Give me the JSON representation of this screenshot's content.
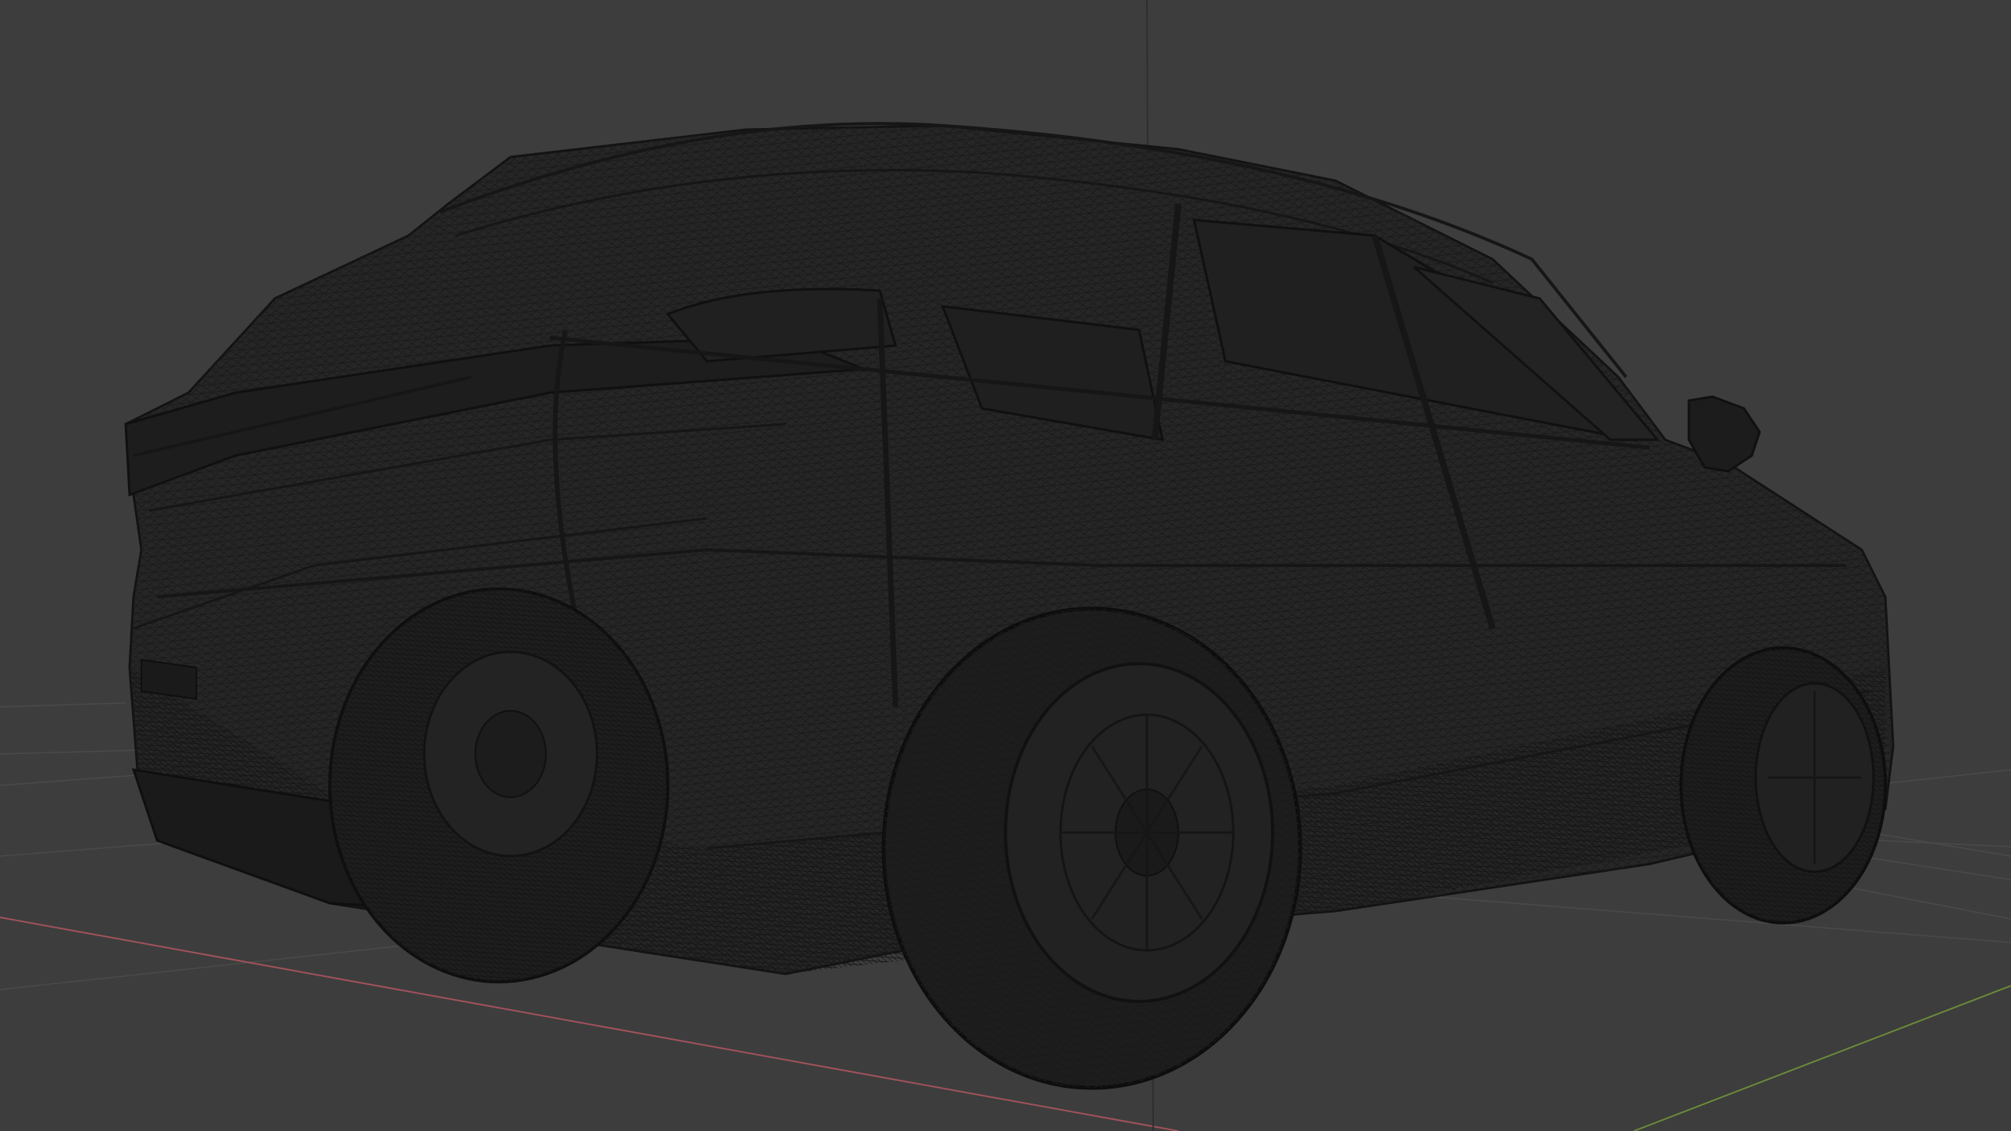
{
  "viewport": {
    "mode": "wireframe",
    "object": "car-mesh",
    "colors": {
      "background": "#3d3d3d",
      "grid_line": "#4a4a4a",
      "x_axis": "#a0525c",
      "y_axis": "#6b8a3a",
      "z_axis": "#2f2f2f",
      "wire_dark": "#141414",
      "wire_mid": "#1e1e1e"
    },
    "icons": [
      "x-axis-line",
      "y-axis-line",
      "z-axis-line",
      "floor-grid"
    ]
  }
}
